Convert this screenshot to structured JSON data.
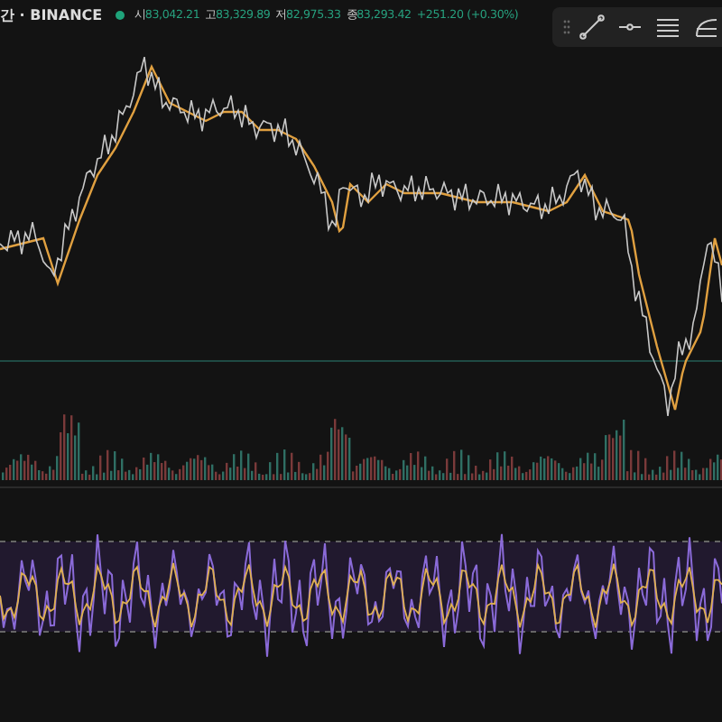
{
  "header": {
    "title": "간 · BINANCE",
    "ohlc": [
      {
        "label": "시",
        "value": "83,042.21"
      },
      {
        "label": "고",
        "value": "83,329.89"
      },
      {
        "label": "저",
        "value": "82,975.33"
      },
      {
        "label": "종",
        "value": "83,293.42"
      }
    ],
    "change": "+251.20 (+0.30%)"
  },
  "toolbar": {
    "tools": [
      {
        "kind": "trend-line"
      },
      {
        "kind": "horizontal-ray"
      },
      {
        "kind": "parallel-lines"
      },
      {
        "kind": "curve"
      }
    ]
  }
}
